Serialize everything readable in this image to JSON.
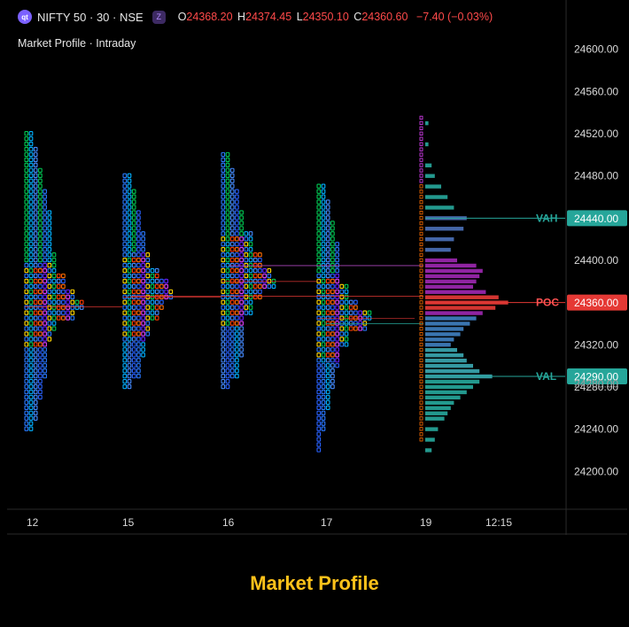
{
  "header": {
    "symbol_icon": "qt",
    "symbol": "NIFTY 50 · 30 · NSE",
    "z_icon": "Z",
    "ohlc": {
      "o_label": "O",
      "o": "24368.20",
      "h_label": "H",
      "h": "24374.45",
      "l_label": "L",
      "l": "24350.10",
      "c_label": "C",
      "c": "24360.60",
      "change": "−7.40 (−0.03%)"
    }
  },
  "subtitle": "Market Profile · Intraday",
  "footer_title": "Market Profile",
  "colors": {
    "down": "#ff4a4a",
    "vah_val": "#26a69a",
    "poc": "#e53935",
    "volume_purple": "#9c27b0",
    "volume_teal": "#26a69a"
  },
  "chart_data": {
    "type": "market_profile",
    "y_ticks": [
      "24600.00",
      "24560.00",
      "24520.00",
      "24480.00",
      "24440.00",
      "24400.00",
      "24360.00",
      "24320.00",
      "24280.00",
      "24240.00",
      "24200.00"
    ],
    "ylim": [
      24170,
      24630
    ],
    "x_ticks": [
      "12",
      "15",
      "16",
      "17",
      "19",
      "12:15"
    ],
    "markers": {
      "vah": {
        "label": "VAH",
        "value": 24440.0,
        "text": "24440.00"
      },
      "poc": {
        "label": "POC",
        "value": 24360.0,
        "text": "24360.00"
      },
      "val": {
        "label": "VAL",
        "value": 24290.0,
        "text": "24290.00"
      }
    },
    "secondary_label": "24280.00",
    "sessions": [
      {
        "day": "12",
        "high": 24520,
        "low": 24240,
        "poc": 24356,
        "widths": [
          [
            24520,
            2
          ],
          [
            24500,
            3
          ],
          [
            24480,
            4
          ],
          [
            24460,
            6
          ],
          [
            24440,
            7
          ],
          [
            24420,
            7
          ],
          [
            24400,
            8
          ],
          [
            24380,
            10
          ],
          [
            24370,
            12
          ],
          [
            24360,
            14
          ],
          [
            24350,
            12
          ],
          [
            24340,
            8
          ],
          [
            24330,
            7
          ],
          [
            24320,
            6
          ],
          [
            24300,
            5
          ],
          [
            24280,
            4
          ],
          [
            24260,
            3
          ],
          [
            24240,
            2
          ]
        ]
      },
      {
        "day": "15",
        "high": 24480,
        "low": 24280,
        "poc": 24365,
        "widths": [
          [
            24480,
            2
          ],
          [
            24460,
            3
          ],
          [
            24440,
            4
          ],
          [
            24420,
            5
          ],
          [
            24400,
            7
          ],
          [
            24390,
            9
          ],
          [
            24380,
            11
          ],
          [
            24370,
            12
          ],
          [
            24360,
            10
          ],
          [
            24350,
            9
          ],
          [
            24340,
            7
          ],
          [
            24320,
            5
          ],
          [
            24300,
            4
          ],
          [
            24280,
            2
          ]
        ]
      },
      {
        "day": "16",
        "high": 24500,
        "low": 24280,
        "poc": 24380,
        "widths": [
          [
            24500,
            2
          ],
          [
            24480,
            3
          ],
          [
            24460,
            4
          ],
          [
            24440,
            6
          ],
          [
            24420,
            8
          ],
          [
            24400,
            10
          ],
          [
            24390,
            12
          ],
          [
            24380,
            13
          ],
          [
            24370,
            10
          ],
          [
            24360,
            8
          ],
          [
            24340,
            6
          ],
          [
            24320,
            5
          ],
          [
            24300,
            4
          ],
          [
            24280,
            2
          ]
        ]
      },
      {
        "day": "17",
        "high": 24470,
        "low": 24220,
        "poc": 24345,
        "widths": [
          [
            24470,
            2
          ],
          [
            24450,
            3
          ],
          [
            24430,
            4
          ],
          [
            24410,
            5
          ],
          [
            24390,
            6
          ],
          [
            24370,
            8
          ],
          [
            24360,
            10
          ],
          [
            24350,
            13
          ],
          [
            24340,
            12
          ],
          [
            24330,
            8
          ],
          [
            24310,
            5
          ],
          [
            24290,
            4
          ],
          [
            24270,
            3
          ],
          [
            24250,
            2
          ],
          [
            24230,
            1
          ]
        ]
      }
    ],
    "volume_profile": [
      [
        24530,
        1
      ],
      [
        24510,
        1
      ],
      [
        24490,
        2
      ],
      [
        24480,
        3
      ],
      [
        24470,
        5
      ],
      [
        24460,
        7
      ],
      [
        24450,
        9
      ],
      [
        24440,
        13
      ],
      [
        24430,
        12
      ],
      [
        24420,
        9
      ],
      [
        24410,
        8
      ],
      [
        24400,
        10
      ],
      [
        24395,
        16
      ],
      [
        24390,
        18
      ],
      [
        24385,
        17
      ],
      [
        24380,
        16
      ],
      [
        24375,
        15
      ],
      [
        24370,
        19
      ],
      [
        24365,
        23
      ],
      [
        24360,
        26
      ],
      [
        24355,
        22
      ],
      [
        24350,
        18
      ],
      [
        24345,
        16
      ],
      [
        24340,
        14
      ],
      [
        24335,
        12
      ],
      [
        24330,
        11
      ],
      [
        24325,
        9
      ],
      [
        24320,
        8
      ],
      [
        24315,
        10
      ],
      [
        24310,
        12
      ],
      [
        24305,
        13
      ],
      [
        24300,
        15
      ],
      [
        24295,
        17
      ],
      [
        24290,
        21
      ],
      [
        24285,
        17
      ],
      [
        24280,
        15
      ],
      [
        24275,
        13
      ],
      [
        24270,
        11
      ],
      [
        24265,
        9
      ],
      [
        24260,
        8
      ],
      [
        24255,
        7
      ],
      [
        24250,
        6
      ],
      [
        24240,
        4
      ],
      [
        24230,
        3
      ],
      [
        24220,
        2
      ]
    ]
  }
}
